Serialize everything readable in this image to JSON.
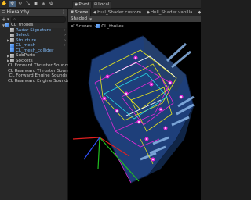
{
  "toolbar": {
    "tools": [
      {
        "icon": "hand-icon",
        "glyph": "✋",
        "active": false
      },
      {
        "icon": "move-icon",
        "glyph": "✥",
        "active": true
      },
      {
        "icon": "rotate-icon",
        "glyph": "↻",
        "active": false
      },
      {
        "icon": "scale-icon",
        "glyph": "⤡",
        "active": false
      },
      {
        "icon": "rect-tool-icon",
        "glyph": "▣",
        "active": false
      },
      {
        "icon": "transform-icon",
        "glyph": "⊕",
        "active": false
      },
      {
        "icon": "custom-tool-icon",
        "glyph": "⚙",
        "active": false
      }
    ],
    "pivot_label": "Pivot",
    "local_label": "Local"
  },
  "hierarchy": {
    "title": "Hierarchy",
    "items": [
      {
        "label": "CL_thoiles",
        "depth": 0,
        "expanded": true,
        "icon": "blue",
        "root": true
      },
      {
        "label": "Radar Signature",
        "depth": 1,
        "icon": "gray",
        "blue": true,
        "chev": true
      },
      {
        "label": "Select",
        "depth": 1,
        "icon": "gray",
        "blue": true,
        "chev": true
      },
      {
        "label": "Structure",
        "depth": 1,
        "icon": "gray",
        "blue": true,
        "collapsed": true,
        "chev": true
      },
      {
        "label": "CL_mesh",
        "depth": 1,
        "icon": "blue",
        "blue": true,
        "chev": true
      },
      {
        "label": "CL_mesh_collider",
        "depth": 1,
        "icon": "blue",
        "blue": true,
        "chev": false
      },
      {
        "label": "SubParts",
        "depth": 1,
        "icon": "gray",
        "collapsed": true
      },
      {
        "label": "Sockets",
        "depth": 1,
        "icon": "gray",
        "collapsed": true
      },
      {
        "label": "CL Forward Thruster Sounds",
        "depth": 1,
        "icon": "gray"
      },
      {
        "label": "CL Rearward Thruster Sounds",
        "depth": 1,
        "icon": "gray"
      },
      {
        "label": "CL Forward Engine Sounds",
        "depth": 1,
        "icon": "gray"
      },
      {
        "label": "CL Rearward Engine Sounds",
        "depth": 1,
        "icon": "gray"
      }
    ]
  },
  "scene": {
    "tabs": [
      {
        "label": "Scene",
        "icon": "scene-tab-icon",
        "glyph": "#",
        "active": true
      },
      {
        "label": "Hull_Shader custom",
        "icon": "shader-graph-icon",
        "glyph": "◆"
      },
      {
        "label": "Hull_Shader vanilla",
        "icon": "shader-graph-icon",
        "glyph": "◆"
      },
      {
        "label": "Hull_Pai",
        "icon": "shader-graph-icon",
        "glyph": "◆"
      }
    ],
    "shading_mode": "Shaded",
    "breadcrumb": {
      "back": "<",
      "scenes": "Scenes",
      "object": "CL_thoiles"
    }
  },
  "colors": {
    "hull": "#1e3f7a",
    "hull_stripe": "#8bb6e8",
    "wire_yellow": "#e8e81c",
    "wire_magenta": "#e629d8",
    "wire_cyan": "#29d8e6",
    "wire_white": "#ffffff",
    "gizmo_red": "#e02020",
    "gizmo_green": "#20c020",
    "gizmo_blue": "#3050ff"
  }
}
